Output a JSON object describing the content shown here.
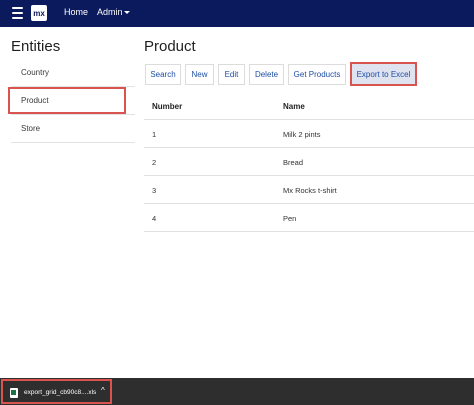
{
  "navbar": {
    "logo_text": "mx",
    "home_label": "Home",
    "admin_label": "Admin",
    "menu_icon": "hamburger-icon",
    "background": "#0b1a5c"
  },
  "sidebar": {
    "title": "Entities",
    "items": [
      {
        "label": "Country",
        "selected": false
      },
      {
        "label": "Product",
        "selected": true
      },
      {
        "label": "Store",
        "selected": false
      }
    ]
  },
  "main": {
    "title": "Product",
    "buttons": {
      "search": "Search",
      "new": "New",
      "edit": "Edit",
      "delete": "Delete",
      "get_products": "Get Products",
      "export": "Export to Excel"
    },
    "table": {
      "columns": [
        "Number",
        "Name"
      ],
      "rows": [
        {
          "number": "1",
          "name": "Milk 2 pints"
        },
        {
          "number": "2",
          "name": "Bread"
        },
        {
          "number": "3",
          "name": "Mx Rocks t-shirt"
        },
        {
          "number": "4",
          "name": "Pen"
        }
      ]
    }
  },
  "download_bar": {
    "file_name": "export_grid_cb90c8....xls",
    "file_icon": "excel-file-icon",
    "chevron": "^"
  },
  "colors": {
    "highlight": "#d9534f",
    "link": "#1d4ea3",
    "export_button_bg": "#dfe3ef"
  }
}
